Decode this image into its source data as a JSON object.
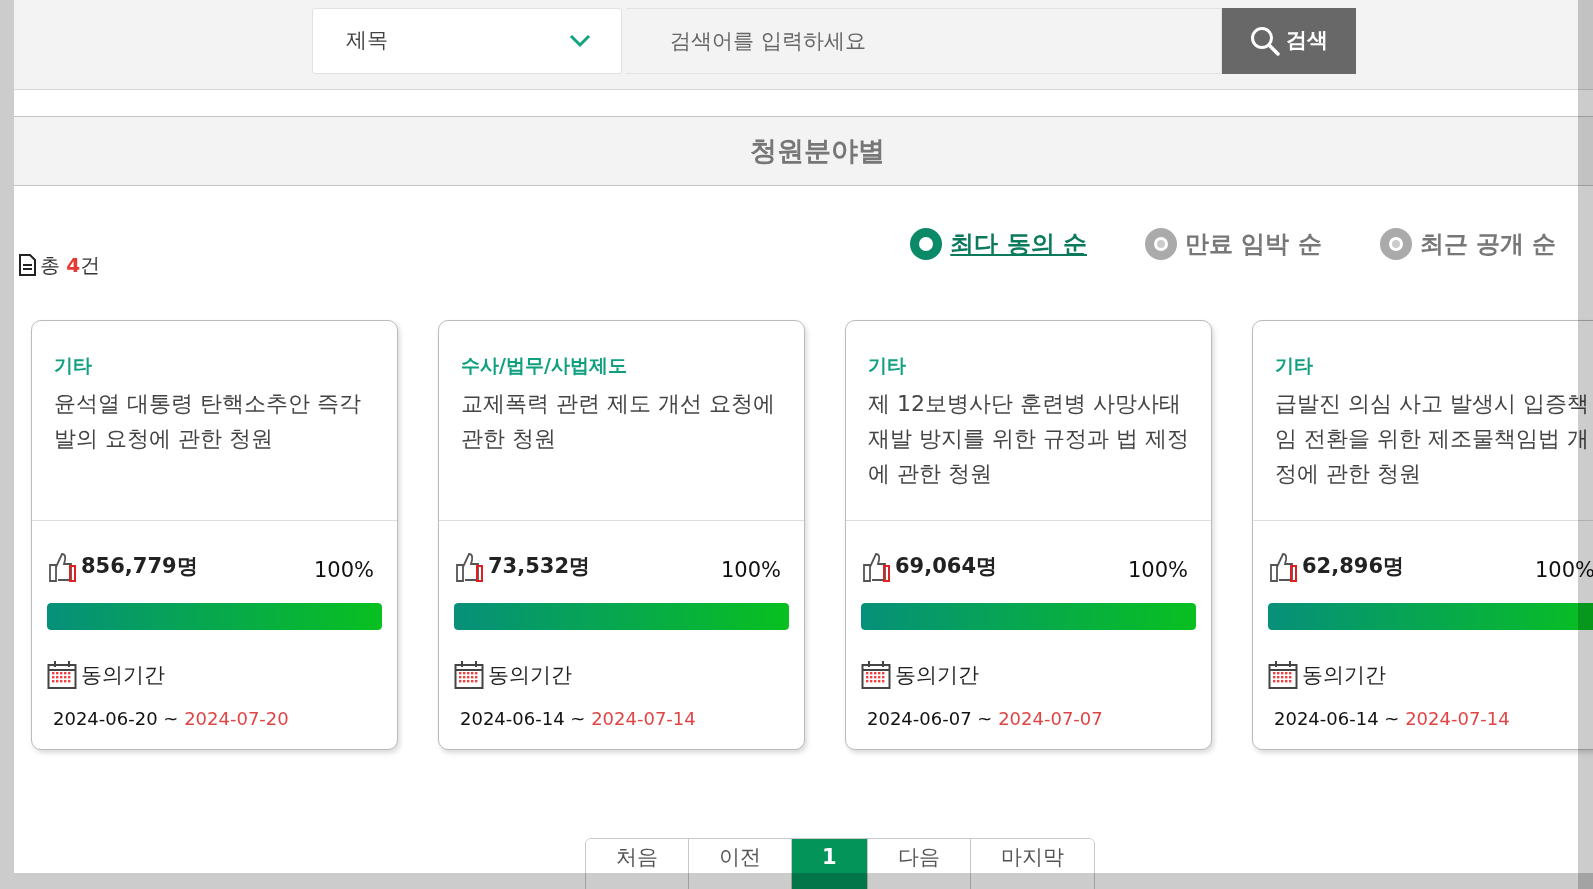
{
  "search": {
    "field": "제목",
    "placeholder": "검색어를 입력하세요",
    "button": "검색"
  },
  "section_title": "청원분야별",
  "total": {
    "prefix": "총",
    "count": "4",
    "suffix": "건"
  },
  "sort_options": [
    {
      "label": "최다 동의 순",
      "selected": true
    },
    {
      "label": "만료 임박 순",
      "selected": false
    },
    {
      "label": "최근 공개 순",
      "selected": false
    }
  ],
  "petitions": [
    {
      "category": "기타",
      "title": "윤석열 대통령 탄핵소추안 즉각 발의 요청에 관한 청원",
      "count": "856,779명",
      "percent": "100%",
      "level": 1,
      "period_label": "동의기간",
      "start": "2024-06-20",
      "separator": "~",
      "end": "2024-07-20"
    },
    {
      "category": "수사/법무/사법제도",
      "title": "교제폭력 관련 제도 개선 요청에 관한 청원",
      "count": "73,532명",
      "percent": "100%",
      "level": 1,
      "period_label": "동의기간",
      "start": "2024-06-14",
      "separator": "~",
      "end": "2024-07-14"
    },
    {
      "category": "기타",
      "title": "제 12보병사단 훈련병 사망사태 재발 방지를 위한 규정과 법 제정에 관한 청원",
      "count": "69,064명",
      "percent": "100%",
      "level": 1,
      "period_label": "동의기간",
      "start": "2024-06-07",
      "separator": "~",
      "end": "2024-07-07"
    },
    {
      "category": "기타",
      "title": "급발진 의심 사고 발생시 입증책임 전환을 위한 제조물책임법 개정에 관한 청원",
      "count": "62,896명",
      "percent": "100%",
      "level": 1,
      "period_label": "동의기간",
      "start": "2024-06-14",
      "separator": "~",
      "end": "2024-07-14"
    }
  ],
  "pagination": [
    {
      "label": "처음",
      "selected": false
    },
    {
      "label": "이전",
      "selected": false
    },
    {
      "label": "1",
      "selected": true
    },
    {
      "label": "다음",
      "selected": false
    },
    {
      "label": "마지막",
      "selected": false
    }
  ]
}
